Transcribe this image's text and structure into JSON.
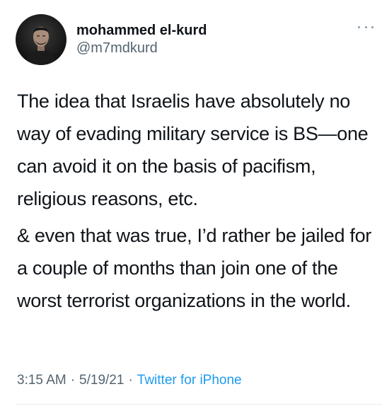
{
  "author": {
    "display_name": "mohammed el-kurd",
    "handle": "@m7mdkurd"
  },
  "more_icon": "more-horizontal-icon",
  "tweet": {
    "paragraphs": [
      "The idea that Israelis have absolutely no way of evading military service is BS—one can avoid it on the basis of pacifism, religious reasons, etc.",
      "& even that was true, I’d rather be jailed for a couple of months than join one of the worst terrorist organizations in the world."
    ]
  },
  "meta": {
    "time": "3:15 AM",
    "separator": "·",
    "date": "5/19/21",
    "source": "Twitter for iPhone"
  },
  "colors": {
    "text": "#0f1419",
    "secondary": "#536471",
    "link": "#1d9bf0",
    "divider": "#e6ecf0"
  }
}
